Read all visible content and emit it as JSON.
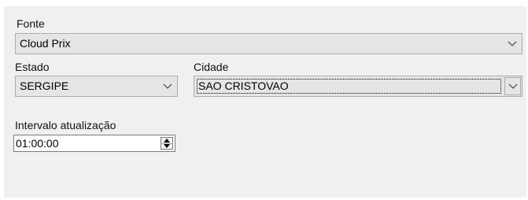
{
  "fonte": {
    "label": "Fonte",
    "value": "Cloud Prix"
  },
  "estado": {
    "label": "Estado",
    "value": "SERGIPE"
  },
  "cidade": {
    "label": "Cidade",
    "value": "SAO CRISTOVAO"
  },
  "intervalo": {
    "label": "Intervalo atualização",
    "value": "01:00:00"
  },
  "icons": {
    "dropdown": "chevron-down-icon",
    "spin_up": "spin-up-icon",
    "spin_down": "spin-down-icon"
  },
  "colors": {
    "panel_bg": "#f0f0f0",
    "combo_bg": "#e5e5e5",
    "border": "#adadad"
  }
}
